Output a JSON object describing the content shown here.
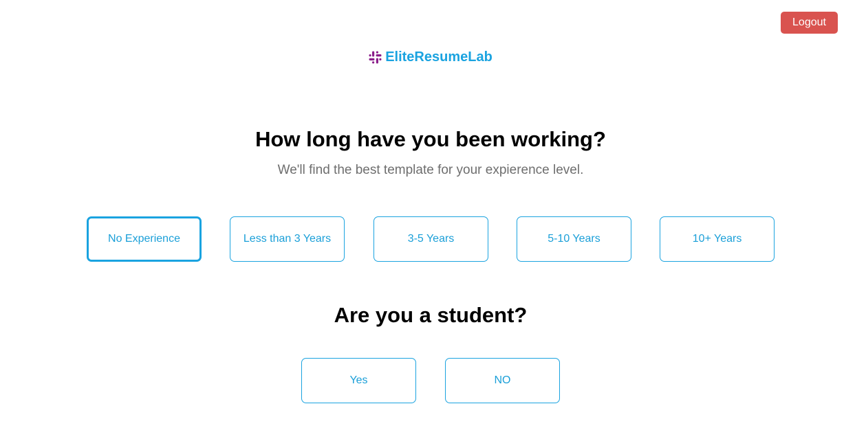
{
  "header": {
    "logout_label": "Logout",
    "logout_color": "#d9534f"
  },
  "brand": {
    "name": "EliteResumeLab",
    "icon": "slack-hash-icon",
    "name_color": "#1aa3e0",
    "icon_color": "#8b1e8b"
  },
  "experience": {
    "title": "How long have you been working?",
    "subtitle": "We'll find the best template for your expierence level.",
    "options": [
      {
        "label": "No Experience",
        "selected": true
      },
      {
        "label": "Less than 3 Years",
        "selected": false
      },
      {
        "label": "3-5 Years",
        "selected": false
      },
      {
        "label": "5-10 Years",
        "selected": false
      },
      {
        "label": "10+ Years",
        "selected": false
      }
    ]
  },
  "student": {
    "title": "Are you a student?",
    "options": [
      {
        "label": "Yes",
        "selected": false
      },
      {
        "label": "NO",
        "selected": false
      }
    ]
  },
  "accent_color": "#1aa3e0"
}
